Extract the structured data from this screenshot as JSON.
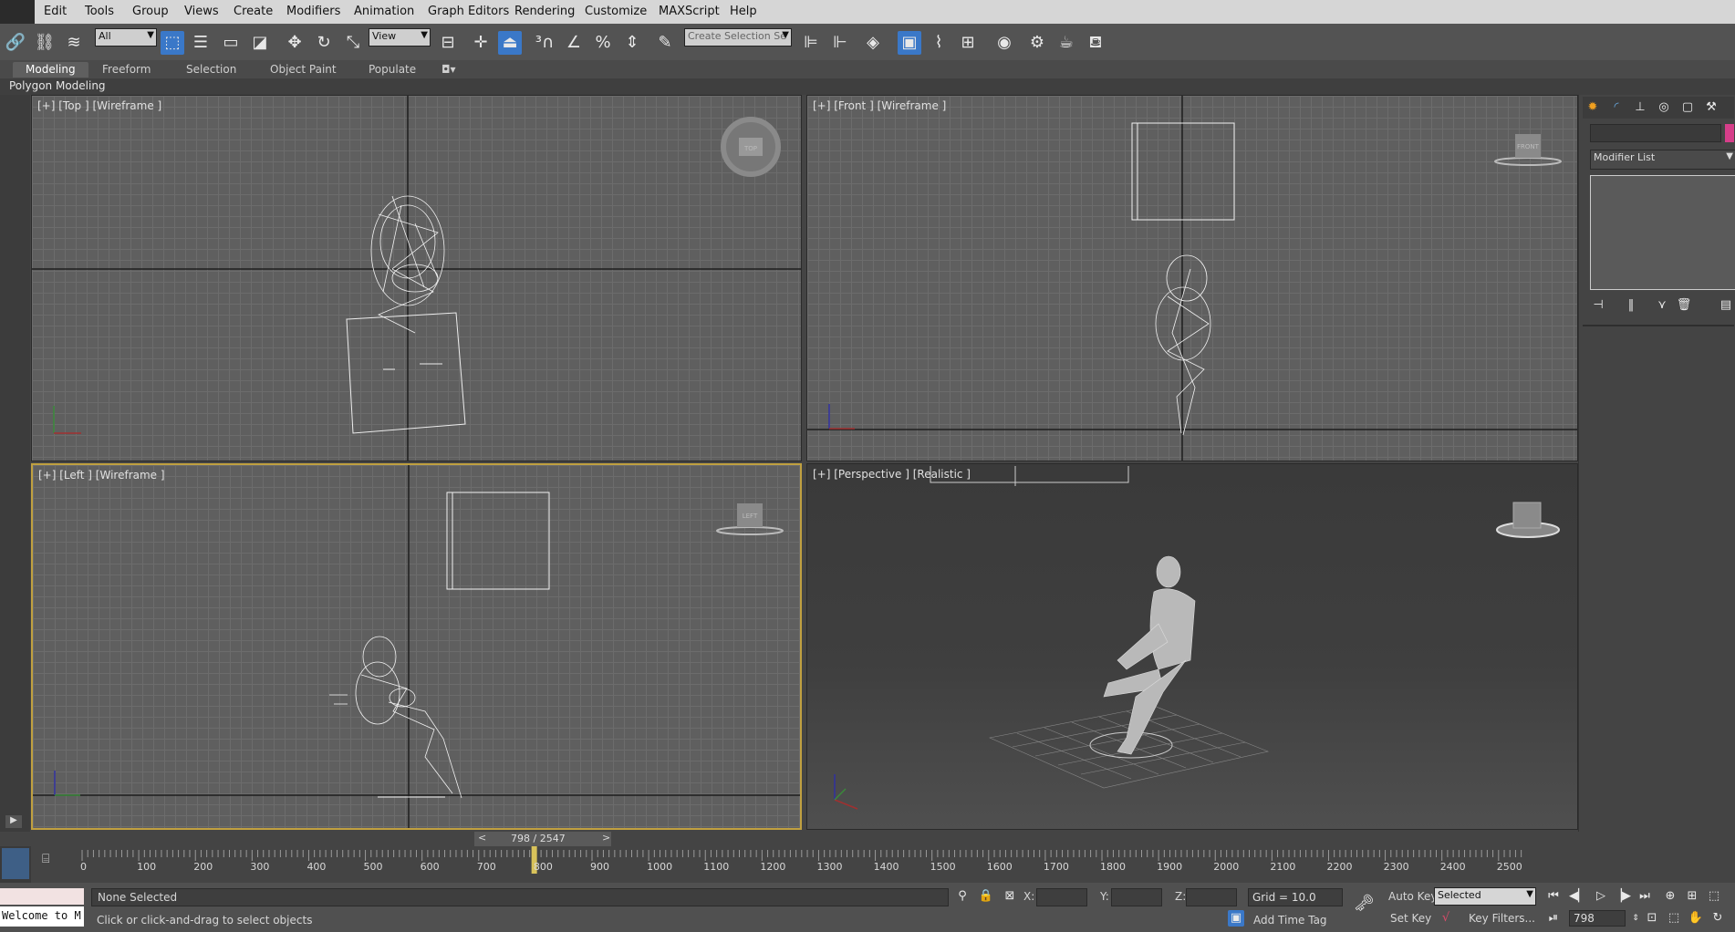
{
  "menu": {
    "items": [
      "Edit",
      "Tools",
      "Group",
      "Views",
      "Create",
      "Modifiers",
      "Animation",
      "Graph Editors",
      "Rendering",
      "Customize",
      "MAXScript",
      "Help"
    ]
  },
  "toolbar": {
    "filter_value": "All",
    "refcoord_value": "View",
    "selection_set_placeholder": "Create Selection Se",
    "icons": [
      "link-icon",
      "unlink-icon",
      "bind-spacewarp-icon",
      "select-object-icon",
      "select-by-name-icon",
      "rect-region-icon",
      "window-crossing-icon",
      "move-icon",
      "rotate-icon",
      "scale-icon",
      "pivot-icon",
      "manipulate-icon",
      "keyboard-shortcut-icon",
      "snap-icon",
      "angle-snap-icon",
      "percent-snap-icon",
      "spinner-snap-icon",
      "edit-named-sets-icon",
      "mirror-icon",
      "align-icon",
      "layer-manager-icon",
      "ribbon-toggle-icon",
      "curve-editor-icon",
      "schematic-view-icon",
      "material-editor-icon",
      "render-setup-icon",
      "render-frame-icon",
      "render-icon"
    ]
  },
  "ribbon": {
    "tabs": [
      "Modeling",
      "Freeform",
      "Selection",
      "Object Paint",
      "Populate"
    ],
    "active_tab": "Modeling",
    "sub_label": "Polygon Modeling"
  },
  "viewports": {
    "top": {
      "label": "[+] [Top ] [Wireframe ]",
      "cube": "TOP"
    },
    "front": {
      "label": "[+] [Front ] [Wireframe ]",
      "cube": "FRONT"
    },
    "left": {
      "label": "[+] [Left ] [Wireframe ]",
      "cube": "LEFT"
    },
    "perspective": {
      "label": "[+] [Perspective ] [Realistic ]"
    }
  },
  "command_panel": {
    "name_field": "",
    "modifier_list": "Modifier List",
    "accent_color": "#d63e8a"
  },
  "timeline": {
    "current": "798 / 2547",
    "prev_label": "<",
    "next_label": ">",
    "ticks": [
      "0",
      "100",
      "200",
      "300",
      "400",
      "500",
      "600",
      "700",
      "800",
      "900",
      "1000",
      "1100",
      "1200",
      "1300",
      "1400",
      "1500",
      "1600",
      "1700",
      "1800",
      "1900",
      "2000",
      "2100",
      "2200",
      "2300",
      "2400",
      "2500"
    ],
    "current_frame": 798,
    "total_frames": 2547
  },
  "status": {
    "maxscript_text": "Welcome to M",
    "selection_status": "None Selected",
    "prompt": "Click or click-and-drag to select objects",
    "x_label": "X:",
    "y_label": "Y:",
    "z_label": "Z:",
    "x_value": "",
    "y_value": "",
    "z_value": "",
    "grid": "Grid = 10.0",
    "add_time_tag": "Add Time Tag",
    "auto_key": "Auto Key",
    "set_key": "Set Key",
    "key_mode_value": "Selected",
    "key_filters": "Key Filters...",
    "frame_value": "798"
  }
}
